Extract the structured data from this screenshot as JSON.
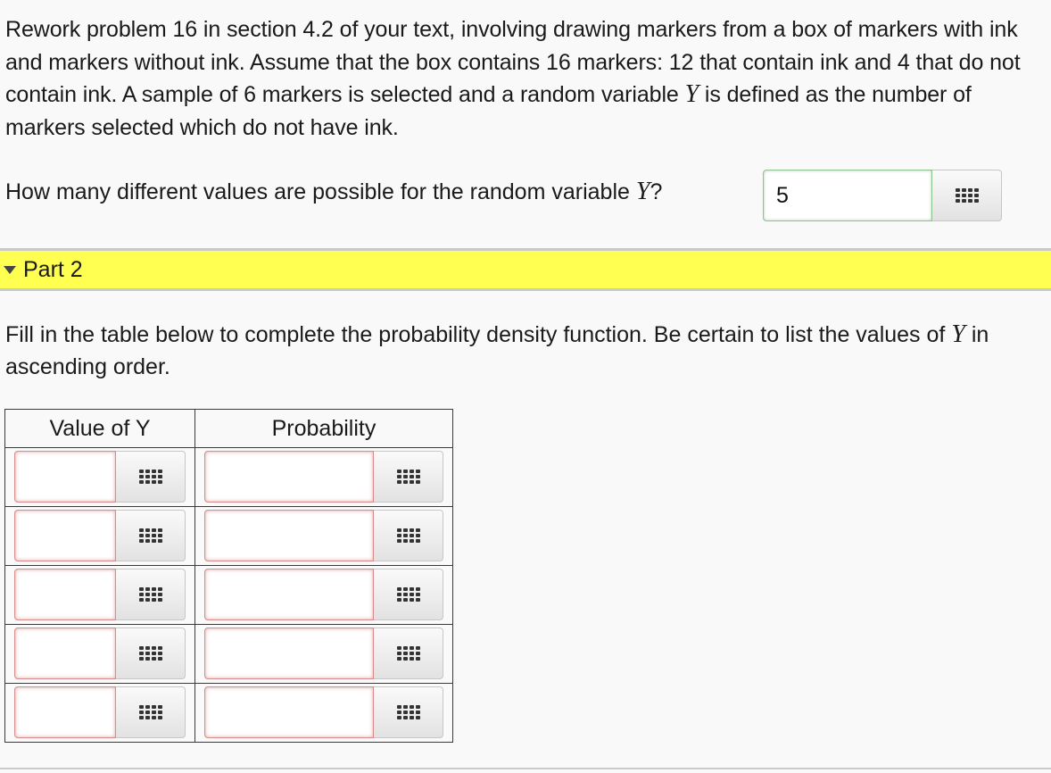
{
  "problem": {
    "text_part1": "Rework problem 16 in section 4.2 of your text, involving drawing markers from a box of markers with ink and markers without ink. Assume that the box contains 16 markers: 12 that contain ink and 4 that do not contain ink. A sample of 6 markers is selected and a random variable ",
    "var": "Y",
    "text_part2": " is defined as the number of markers selected which do not have ink."
  },
  "question1": {
    "label_prefix": "How many different values are possible for the random variable ",
    "var": "Y",
    "label_suffix": "?",
    "answer_value": "5"
  },
  "part2": {
    "title": "Part 2",
    "instructions_prefix": "Fill in the table below to complete the probability density function. Be certain to list the values of ",
    "var": "Y",
    "instructions_suffix": " in ascending order."
  },
  "table": {
    "headers": [
      "Value of Y",
      "Probability"
    ],
    "rows": [
      {
        "value": "",
        "probability": ""
      },
      {
        "value": "",
        "probability": ""
      },
      {
        "value": "",
        "probability": ""
      },
      {
        "value": "",
        "probability": ""
      },
      {
        "value": "",
        "probability": ""
      }
    ]
  },
  "icons": {
    "palette": "keypad-grid-icon",
    "collapse": "caret-down-icon"
  },
  "colors": {
    "part_bar": "#ffff52",
    "valid_border": "#8fc28f",
    "invalid_border": "#d88c8c"
  }
}
